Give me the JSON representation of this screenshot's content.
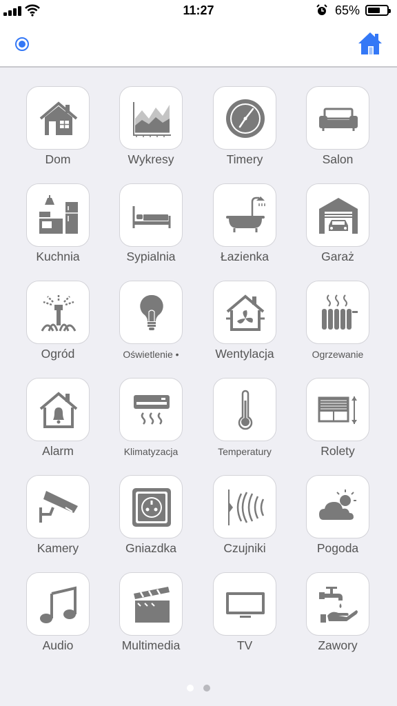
{
  "status_bar": {
    "time": "11:27",
    "battery_percent_label": "65%",
    "battery_level": 0.65
  },
  "header": {
    "status_indicator_color": "#3478f6",
    "home_icon": "home-icon",
    "home_color": "#3478f6"
  },
  "tiles": [
    {
      "label": "Dom",
      "icon": "house-icon"
    },
    {
      "label": "Wykresy",
      "icon": "chart-icon"
    },
    {
      "label": "Timery",
      "icon": "clock-icon"
    },
    {
      "label": "Salon",
      "icon": "sofa-icon"
    },
    {
      "label": "Kuchnia",
      "icon": "kitchen-icon"
    },
    {
      "label": "Sypialnia",
      "icon": "bed-icon"
    },
    {
      "label": "Łazienka",
      "icon": "bathtub-icon"
    },
    {
      "label": "Garaż",
      "icon": "garage-icon"
    },
    {
      "label": "Ogród",
      "icon": "sprinkler-icon"
    },
    {
      "label": "Oświetlenie •",
      "icon": "lightbulb-icon"
    },
    {
      "label": "Wentylacja",
      "icon": "ventilation-icon"
    },
    {
      "label": "Ogrzewanie",
      "icon": "radiator-icon"
    },
    {
      "label": "Alarm",
      "icon": "alarm-bell-icon"
    },
    {
      "label": "Klimatyzacja",
      "icon": "air-conditioner-icon"
    },
    {
      "label": "Temperatury",
      "icon": "thermometer-icon"
    },
    {
      "label": "Rolety",
      "icon": "blinds-icon"
    },
    {
      "label": "Kamery",
      "icon": "camera-icon"
    },
    {
      "label": "Gniazdka",
      "icon": "socket-icon"
    },
    {
      "label": "Czujniki",
      "icon": "sensor-icon"
    },
    {
      "label": "Pogoda",
      "icon": "weather-icon"
    },
    {
      "label": "Audio",
      "icon": "music-note-icon"
    },
    {
      "label": "Multimedia",
      "icon": "clapperboard-icon"
    },
    {
      "label": "TV",
      "icon": "tv-icon"
    },
    {
      "label": "Zawory",
      "icon": "faucet-icon"
    }
  ],
  "pager": {
    "pages": 2,
    "current": 1
  },
  "colors": {
    "icon": "#7a7a7a",
    "label": "#555555",
    "background": "#efeff4"
  }
}
